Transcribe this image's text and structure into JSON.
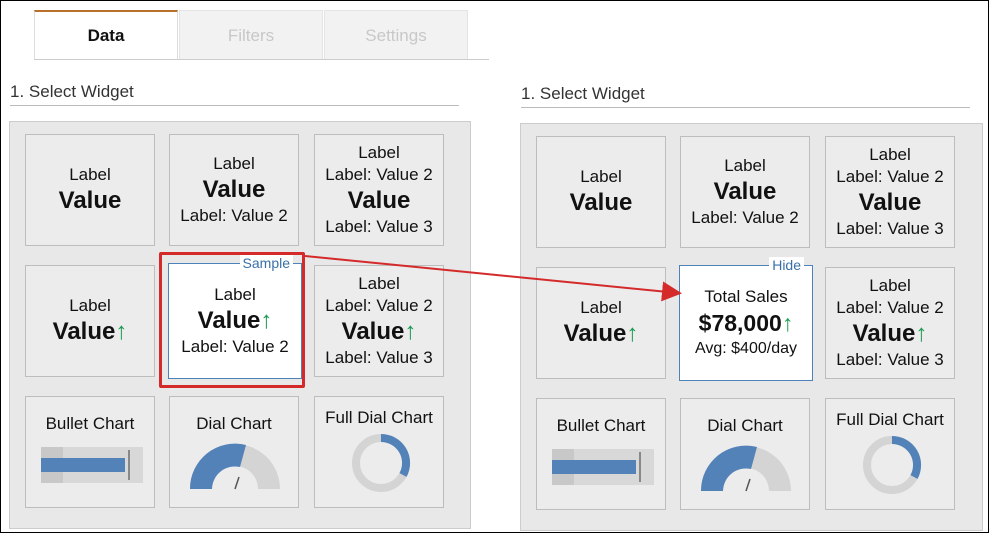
{
  "tabs": [
    {
      "label": "Data",
      "active": true
    },
    {
      "label": "Filters",
      "active": false
    },
    {
      "label": "Settings",
      "active": false
    }
  ],
  "left_panel": {
    "section_title": "1. Select Widget",
    "tiles": {
      "t1": {
        "label": "Label",
        "value": "Value"
      },
      "t2": {
        "label": "Label",
        "value": "Value",
        "sub": "Label: Value 2"
      },
      "t3": {
        "label": "Label",
        "sub1": "Label: Value 2",
        "value": "Value",
        "sub2": "Label: Value 3"
      },
      "t4": {
        "label": "Label",
        "value": "Value",
        "arrow": "↑"
      },
      "t5": {
        "tag": "Sample",
        "label": "Label",
        "value": "Value",
        "arrow": "↑",
        "sub": "Label: Value 2"
      },
      "t6": {
        "label": "Label",
        "sub1": "Label: Value 2",
        "value": "Value",
        "arrow": "↑",
        "sub2": "Label: Value 3"
      },
      "t7": {
        "title": "Bullet Chart"
      },
      "t8": {
        "title": "Dial Chart"
      },
      "t9": {
        "title": "Full Dial Chart"
      }
    }
  },
  "right_panel": {
    "section_title": "1. Select Widget",
    "tiles": {
      "t1": {
        "label": "Label",
        "value": "Value"
      },
      "t2": {
        "label": "Label",
        "value": "Value",
        "sub": "Label: Value 2"
      },
      "t3": {
        "label": "Label",
        "sub1": "Label: Value 2",
        "value": "Value",
        "sub2": "Label: Value 3"
      },
      "t4": {
        "label": "Label",
        "value": "Value",
        "arrow": "↑"
      },
      "t5": {
        "tag": "Hide",
        "label": "Total Sales",
        "value": "$78,000",
        "arrow": "↑",
        "sub": "Avg: $400/day"
      },
      "t6": {
        "label": "Label",
        "sub1": "Label: Value 2",
        "value": "Value",
        "arrow": "↑",
        "sub2": "Label: Value 3"
      },
      "t7": {
        "title": "Bullet Chart"
      },
      "t8": {
        "title": "Dial Chart"
      },
      "t9": {
        "title": "Full Dial Chart"
      }
    }
  },
  "colors": {
    "accent_tab": "#b9702b",
    "selected_border": "#4d83b8",
    "highlight": "#d42a2a",
    "up_arrow": "#1a9c52",
    "chart_fill": "#5282b8"
  }
}
